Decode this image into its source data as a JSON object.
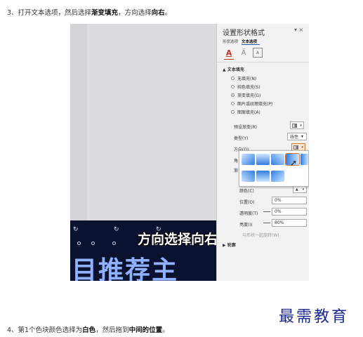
{
  "instructions": {
    "step3": {
      "prefix": "3、打开文本选项，然后选择",
      "bold1": "渐变填充",
      "mid": "，方向选择",
      "bold2": "向右",
      "suffix": "。"
    },
    "step4": {
      "prefix": "4、第1个色块颜色选择为",
      "bold1": "白色",
      "mid": "，然后拖到",
      "bold2": "中间的位置",
      "suffix": "。"
    }
  },
  "slide": {
    "caption": "方向选择向右",
    "title_text": "目推荐主"
  },
  "panel": {
    "title": "设置形状格式",
    "controls": "▾ ×",
    "tabs": {
      "shape": "形状选项",
      "text": "文本选项"
    },
    "icon_box_glyph": "A",
    "section_title": "▲ 文本填充",
    "fill_options": [
      {
        "label": "无填充(N)",
        "selected": false
      },
      {
        "label": "纯色填充(S)",
        "selected": false
      },
      {
        "label": "渐变填充(G)",
        "selected": true
      },
      {
        "label": "图片或纹理填充(P)",
        "selected": false
      },
      {
        "label": "图案填充(A)",
        "selected": false
      }
    ],
    "preset_label": "预设渐变(R)",
    "type_label": "类型(Y)",
    "type_value": "线性",
    "direction_label": "方向(D)",
    "angle_label": "角",
    "stops_label": "渐",
    "color_label": "颜色(C)",
    "position_label": "位置(O)",
    "position_value": "0%",
    "transparency_label": "透明度(T)",
    "transparency_value": "0%",
    "brightness_label": "亮度(I)",
    "brightness_value": "80%",
    "rotate_label": "与形状一起旋转(W)",
    "outline_label": "▶ 轮廓"
  },
  "watermark": "最需教育",
  "colors": {
    "panel_bg": "#f2f2f2",
    "accent_orange": "#d9782f",
    "tile_blue_light": "#cfe5ff",
    "tile_blue_dark": "#2f7de0",
    "watermark_blue": "#1b2a8a"
  }
}
